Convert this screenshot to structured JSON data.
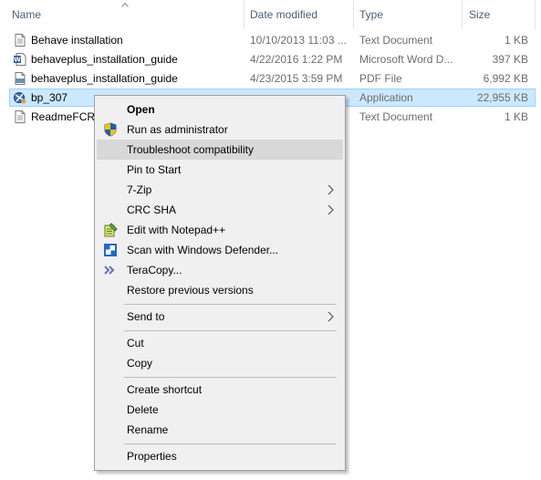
{
  "columns": {
    "name": "Name",
    "date_modified": "Date modified",
    "type": "Type",
    "size": "Size"
  },
  "files": [
    {
      "name": "Behave installation",
      "date": "10/10/2013 11:03 ...",
      "type": "Text Document",
      "size": "1 KB",
      "icon": "text-document-icon"
    },
    {
      "name": "behaveplus_installation_guide",
      "date": "4/22/2016 1:22 PM",
      "type": "Microsoft Word D...",
      "size": "397 KB",
      "icon": "word-document-icon"
    },
    {
      "name": "behaveplus_installation_guide",
      "date": "4/23/2015 3:59 PM",
      "type": "PDF File",
      "size": "6,992 KB",
      "icon": "pdf-file-icon"
    },
    {
      "name": "bp_307",
      "date": "",
      "type": "Application",
      "size": "22,955 KB",
      "icon": "application-icon"
    },
    {
      "name": "ReadmeFCR",
      "date": "",
      "type": "Text Document",
      "size": "1 KB",
      "icon": "text-document-icon"
    }
  ],
  "context_menu": {
    "open": "Open",
    "run_as_admin": "Run as administrator",
    "troubleshoot": "Troubleshoot compatibility",
    "pin_to_start": "Pin to Start",
    "seven_zip": "7-Zip",
    "crc_sha": "CRC SHA",
    "edit_notepad": "Edit with Notepad++",
    "scan_defender": "Scan with Windows Defender...",
    "teracopy": "TeraCopy...",
    "restore_versions": "Restore previous versions",
    "send_to": "Send to",
    "cut": "Cut",
    "copy": "Copy",
    "create_shortcut": "Create shortcut",
    "delete": "Delete",
    "rename": "Rename",
    "properties": "Properties"
  },
  "colors": {
    "selection": "#cce8ff",
    "menu_bg": "#f0f0f0",
    "menu_highlight": "#d8d8d8",
    "header_text": "#4c607a"
  }
}
